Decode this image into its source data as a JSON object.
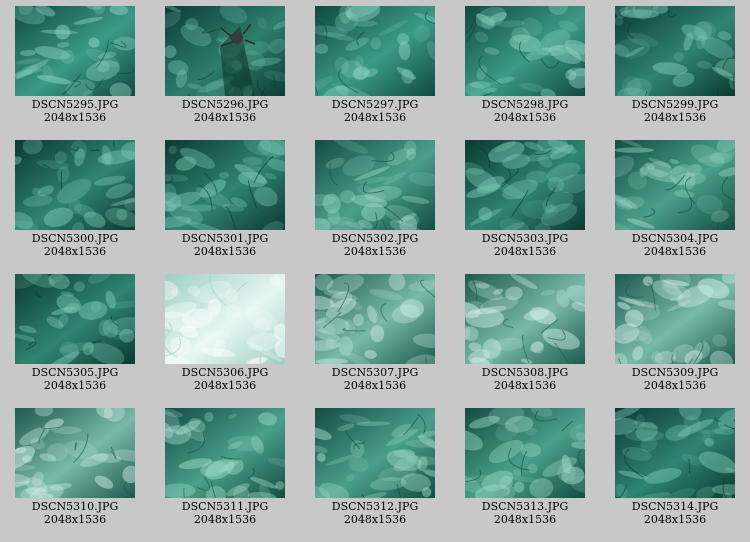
{
  "gallery": {
    "items": [
      {
        "filename": "DSCN5295.JPG",
        "dimensions": "2048x1536",
        "tone": "deep"
      },
      {
        "filename": "DSCN5296.JPG",
        "dimensions": "2048x1536",
        "tone": "creature"
      },
      {
        "filename": "DSCN5297.JPG",
        "dimensions": "2048x1536",
        "tone": "deep"
      },
      {
        "filename": "DSCN5298.JPG",
        "dimensions": "2048x1536",
        "tone": "deep"
      },
      {
        "filename": "DSCN5299.JPG",
        "dimensions": "2048x1536",
        "tone": "dark"
      },
      {
        "filename": "DSCN5300.JPG",
        "dimensions": "2048x1536",
        "tone": "dark"
      },
      {
        "filename": "DSCN5301.JPG",
        "dimensions": "2048x1536",
        "tone": "dark"
      },
      {
        "filename": "DSCN5302.JPG",
        "dimensions": "2048x1536",
        "tone": "mid"
      },
      {
        "filename": "DSCN5303.JPG",
        "dimensions": "2048x1536",
        "tone": "dark"
      },
      {
        "filename": "DSCN5304.JPG",
        "dimensions": "2048x1536",
        "tone": "mid"
      },
      {
        "filename": "DSCN5305.JPG",
        "dimensions": "2048x1536",
        "tone": "dark"
      },
      {
        "filename": "DSCN5306.JPG",
        "dimensions": "2048x1536",
        "tone": "bright"
      },
      {
        "filename": "DSCN5307.JPG",
        "dimensions": "2048x1536",
        "tone": "light"
      },
      {
        "filename": "DSCN5308.JPG",
        "dimensions": "2048x1536",
        "tone": "light"
      },
      {
        "filename": "DSCN5309.JPG",
        "dimensions": "2048x1536",
        "tone": "light"
      },
      {
        "filename": "DSCN5310.JPG",
        "dimensions": "2048x1536",
        "tone": "light"
      },
      {
        "filename": "DSCN5311.JPG",
        "dimensions": "2048x1536",
        "tone": "mid"
      },
      {
        "filename": "DSCN5312.JPG",
        "dimensions": "2048x1536",
        "tone": "mid"
      },
      {
        "filename": "DSCN5313.JPG",
        "dimensions": "2048x1536",
        "tone": "mid"
      },
      {
        "filename": "DSCN5314.JPG",
        "dimensions": "2048x1536",
        "tone": "dark"
      }
    ]
  },
  "colors": {
    "background": "#c8c8c8",
    "text": "#000000",
    "deep": "#1f6f5e",
    "dark": "#164f44",
    "mid": "#2a7a68",
    "light": "#5ca592",
    "bright": "#eefaf6"
  }
}
